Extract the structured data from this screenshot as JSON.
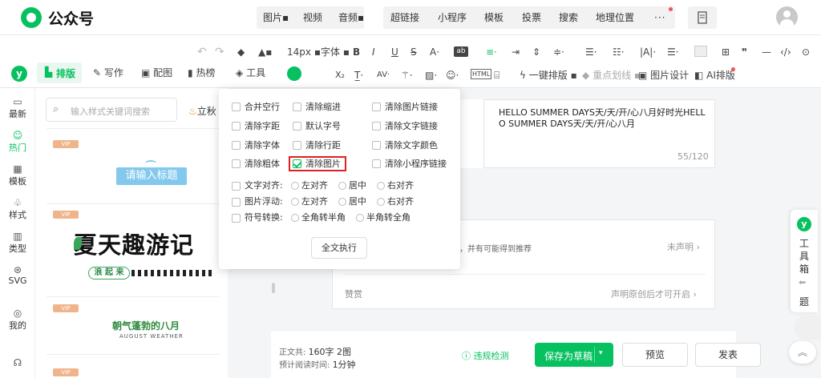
{
  "header": {
    "logo_text": "公众号",
    "insert_tools": [
      "图片",
      "视频",
      "音频"
    ],
    "features": [
      "超链接",
      "小程序",
      "模板",
      "投票",
      "搜索",
      "地理位置"
    ],
    "more": "···"
  },
  "toolbar": {
    "font_size": "14px",
    "font_family": "字体",
    "tabs": [
      "排版",
      "写作",
      "配图",
      "热榜",
      "工具"
    ],
    "row2": {
      "one_click": "一键排版",
      "highlight": "重点划线",
      "image_design": "图片设计",
      "ai_layout": "AI排版"
    }
  },
  "sidebar": {
    "items": [
      "最新",
      "热门",
      "模板",
      "样式",
      "类型",
      "SVG",
      "我的"
    ]
  },
  "panel": {
    "search_placeholder": "输入样式关键词搜索",
    "tag": "立秋",
    "vip": "VIP",
    "card1_title": "请输入标题",
    "card2_title": "夏天趣游记",
    "card2_sub": "浪 起 来",
    "card3_title": "朝气蓬勃的八月",
    "card3_sub": "AUGUST WEATHER"
  },
  "popup": {
    "checks": [
      [
        "合并空行",
        "清除缩进",
        "清除图片链接"
      ],
      [
        "清除字距",
        "默认字号",
        "清除文字链接"
      ],
      [
        "清除字体",
        "清除行距",
        "清除文字颜色"
      ],
      [
        "清除粗体",
        "清除图片",
        "清除小程序链接"
      ]
    ],
    "checked": "清除图片",
    "align_label": "文字对齐:",
    "align_opts": [
      "左对齐",
      "居中",
      "右对齐"
    ],
    "float_label": "图片浮动:",
    "float_opts": [
      "左对齐",
      "居中",
      "右对齐"
    ],
    "convert_label": "符号转换:",
    "convert_opts": [
      "全角转半角",
      "半角转全角"
    ],
    "execute": "全文执行"
  },
  "editor": {
    "summary": "HELLO SUMMER DAYS天/天/开/心八月好时光HELLO SUMMER DAYS天/天/开/心八月",
    "summary_count": "55/120",
    "original_hint": "权保护，并有可能得到推荐",
    "not_declared": "未声明",
    "reward_label": "赞赏",
    "reward_hint": "声明原创后才可开启"
  },
  "footer": {
    "body_label": "正文共:",
    "body_value": "160字 2图",
    "read_label": "预计阅读时间:",
    "read_value": "1分钟",
    "check": "违规检测",
    "save": "保存为草稿",
    "preview": "预览",
    "publish": "发表"
  },
  "dock": {
    "label_top": "工具箱",
    "label_bottom": "题"
  },
  "colors": {
    "brand": "#07c160",
    "highlight": "#e02020",
    "vip": "#f0b48a"
  }
}
